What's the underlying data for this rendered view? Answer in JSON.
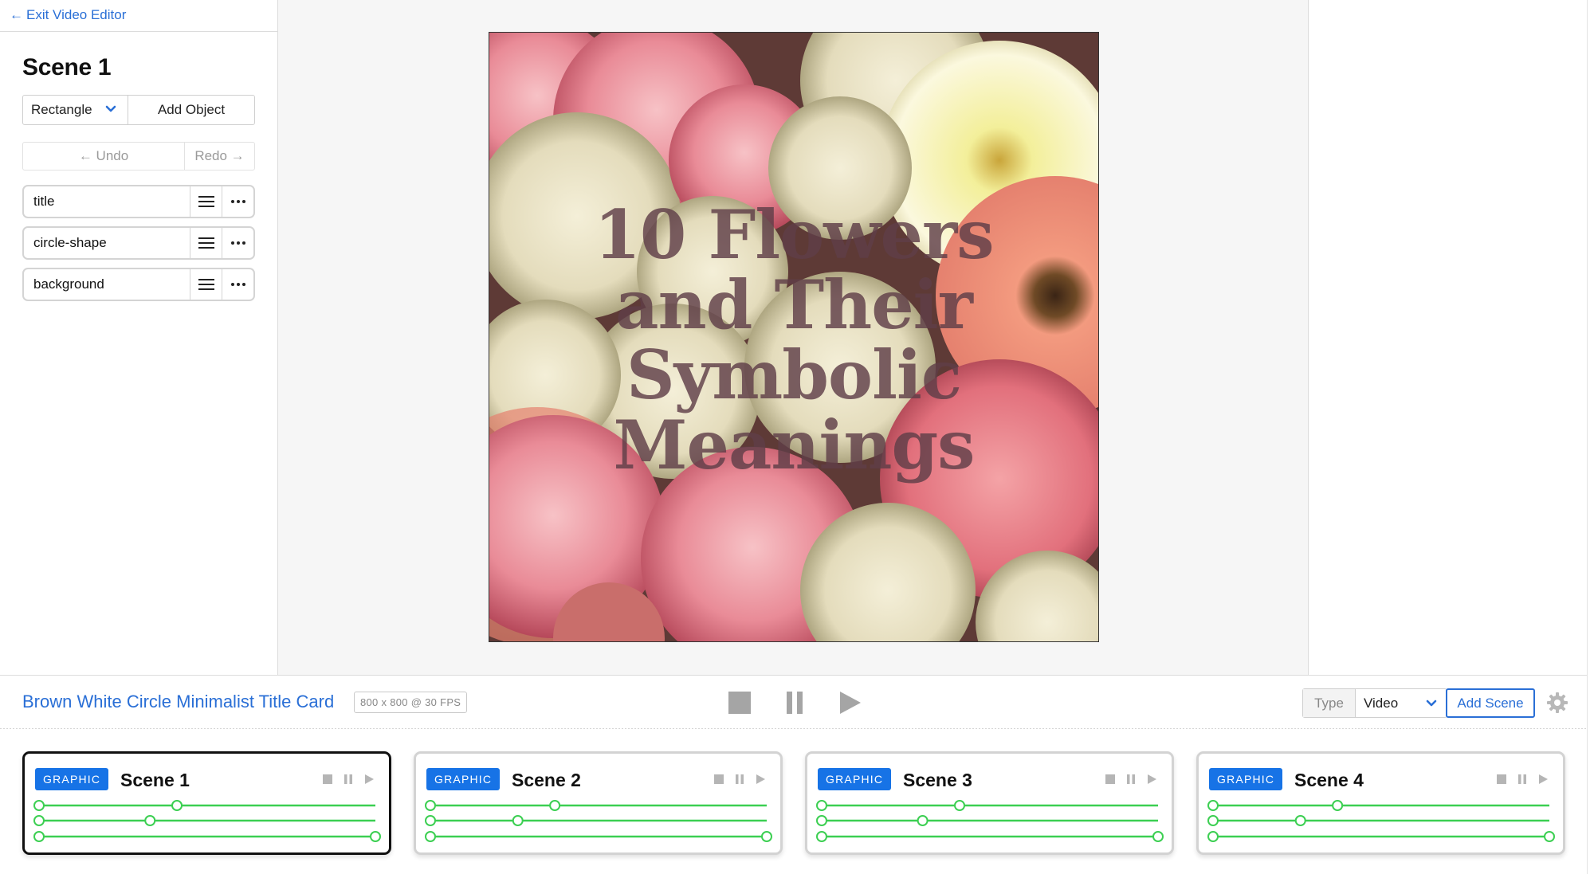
{
  "left_panel": {
    "exit_label": "Exit Video Editor",
    "scene_title": "Scene 1",
    "shape_select": "Rectangle",
    "add_object": "Add Object",
    "undo": "Undo",
    "redo": "Redo",
    "layers": [
      {
        "name": "title"
      },
      {
        "name": "circle-shape"
      },
      {
        "name": "background"
      }
    ]
  },
  "preview": {
    "title_lines": [
      "10 Flowers",
      "and Their",
      "Symbolic",
      "Meanings"
    ]
  },
  "control_bar": {
    "project_title": "Brown White Circle Minimalist Title Card",
    "resolution": "800 x 800 @ 30 FPS",
    "type_label": "Type",
    "type_value": "Video",
    "add_scene": "Add Scene"
  },
  "scenes": [
    {
      "badge": "GRAPHIC",
      "name": "Scene 1",
      "active": true,
      "handles": [
        0.41,
        0.33,
        1.0
      ]
    },
    {
      "badge": "GRAPHIC",
      "name": "Scene 2",
      "active": false,
      "handles": [
        0.37,
        0.26,
        1.0
      ]
    },
    {
      "badge": "GRAPHIC",
      "name": "Scene 3",
      "active": false,
      "handles": [
        0.41,
        0.3,
        1.0
      ]
    },
    {
      "badge": "GRAPHIC",
      "name": "Scene 4",
      "active": false,
      "handles": [
        0.37,
        0.26,
        1.0
      ]
    }
  ],
  "colors": {
    "accent": "#2a6fd6",
    "badge": "#1773e6",
    "track": "#3ccf52"
  }
}
